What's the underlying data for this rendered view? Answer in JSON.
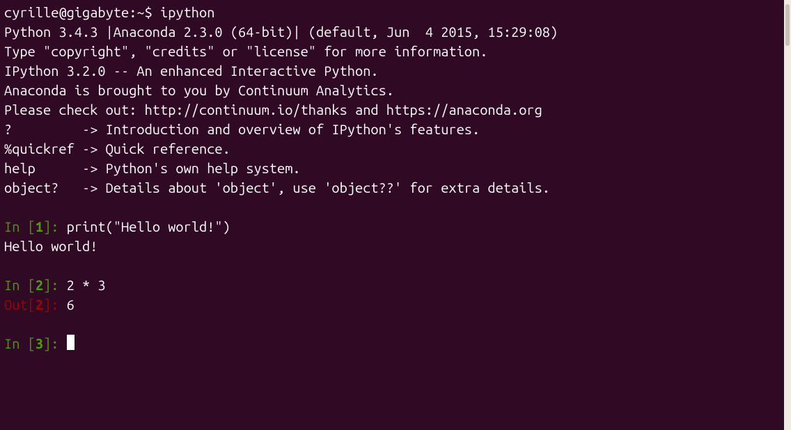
{
  "shell": {
    "prompt": "cyrille@gigabyte:~$ ",
    "command": "ipython"
  },
  "banner": {
    "line1": "Python 3.4.3 |Anaconda 2.3.0 (64-bit)| (default, Jun  4 2015, 15:29:08)",
    "line2": "Type \"copyright\", \"credits\" or \"license\" for more information.",
    "line3": "",
    "line4": "IPython 3.2.0 -- An enhanced Interactive Python.",
    "line5": "Anaconda is brought to you by Continuum Analytics.",
    "line6": "Please check out: http://continuum.io/thanks and https://anaconda.org",
    "line7": "?         -> Introduction and overview of IPython's features.",
    "line8": "%quickref -> Quick reference.",
    "line9": "help      -> Python's own help system.",
    "line10": "object?   -> Details about 'object', use 'object??' for extra details."
  },
  "cells": {
    "in1_prefix": "In [",
    "in1_num": "1",
    "in1_suffix": "]: ",
    "in1_code": "print(\"Hello world!\")",
    "in1_output": "Hello world!",
    "in2_prefix": "In [",
    "in2_num": "2",
    "in2_suffix": "]: ",
    "in2_code": "2 * 3",
    "out2_prefix": "Out[",
    "out2_num": "2",
    "out2_suffix": "]: ",
    "out2_result": "6",
    "in3_prefix": "In [",
    "in3_num": "3",
    "in3_suffix": "]: "
  }
}
